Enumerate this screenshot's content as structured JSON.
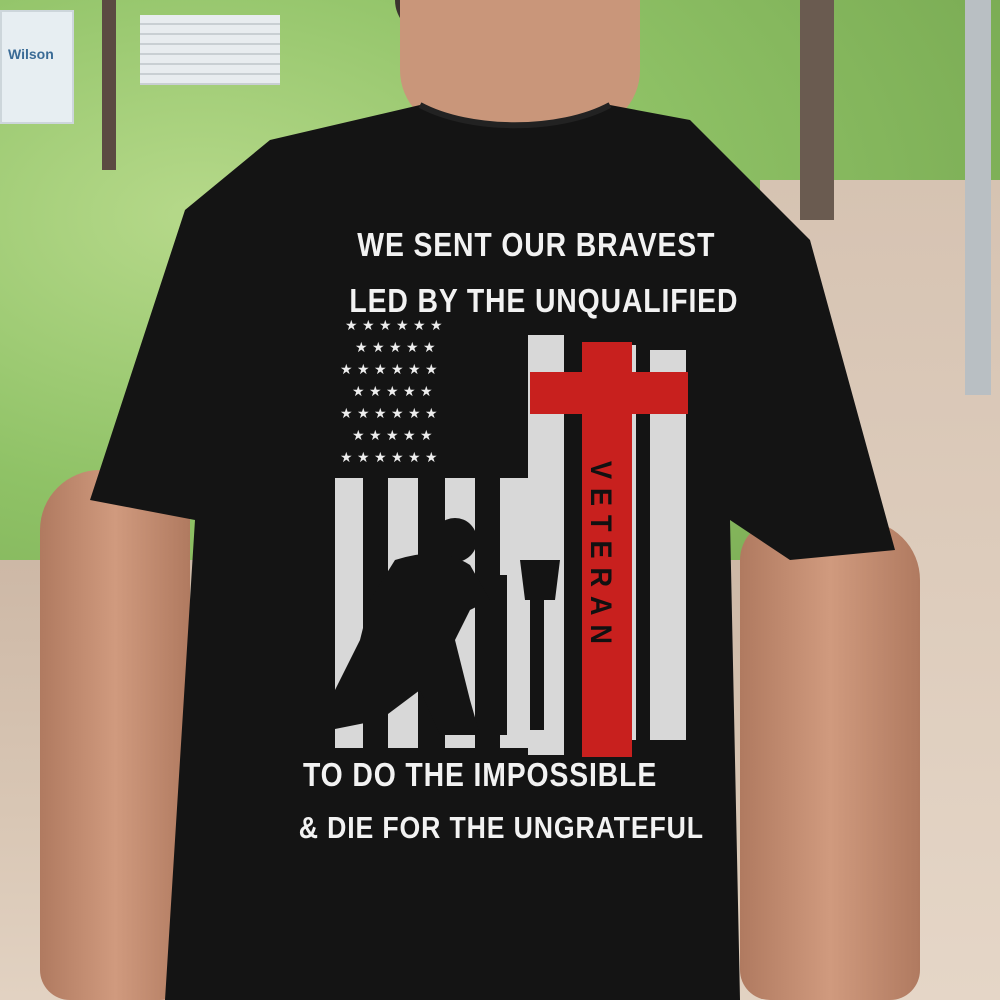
{
  "background": {
    "sign_text": "Wilson"
  },
  "shirt": {
    "slogan_top_line1": "WE SENT OUR BRAVEST",
    "slogan_top_line2": "LED BY THE UNQUALIFIED",
    "cross_text": "VETERAN",
    "slogan_bottom_line1": "TO DO THE IMPOSSIBLE",
    "slogan_bottom_line2": "& DIE FOR THE UNGRATEFUL",
    "colors": {
      "shirt": "#111111",
      "print_white": "#f2f2f2",
      "cross_red": "#c8201e"
    }
  }
}
